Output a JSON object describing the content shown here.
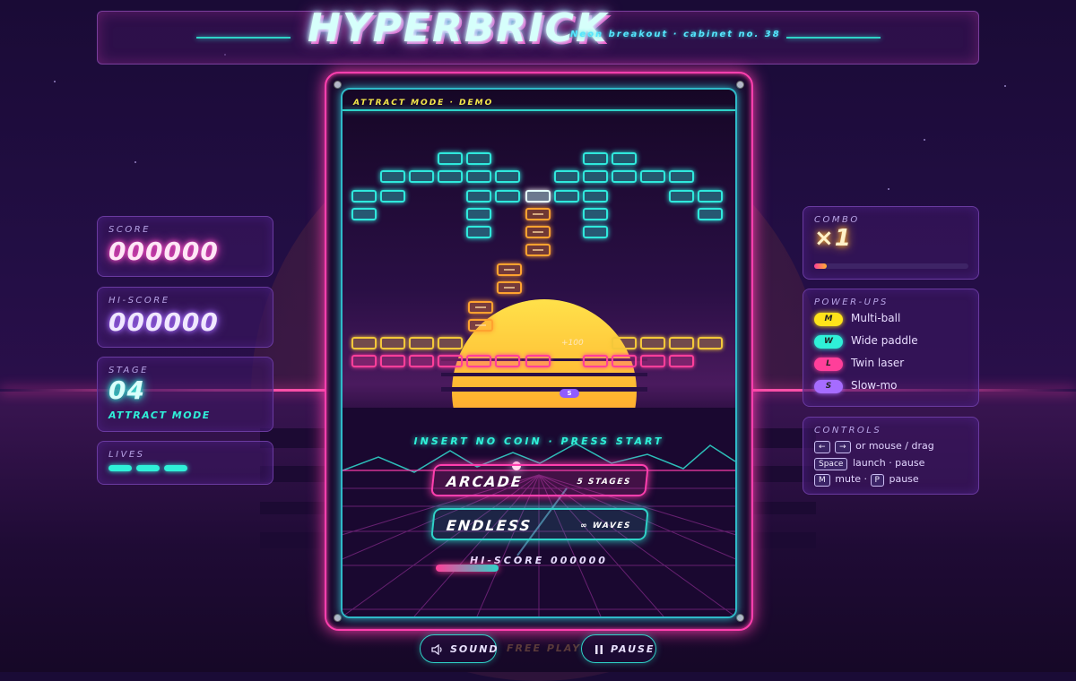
{
  "header": {
    "title": "HYPERBRICK",
    "tagline": "Neon breakout · cabinet no. 38"
  },
  "left_panels": {
    "score": {
      "label": "SCORE",
      "value": "000000"
    },
    "hiscore": {
      "label": "HI-SCORE",
      "value": "000000"
    },
    "stage": {
      "label": "STAGE",
      "value": "04",
      "mode": "ATTRACT MODE"
    },
    "lives": {
      "label": "LIVES",
      "count": 3
    }
  },
  "right_panels": {
    "combo": {
      "label": "COMBO",
      "value": "×1",
      "meter": 0.08
    },
    "powerups": {
      "label": "POWER-UPS",
      "items": [
        {
          "key": "M",
          "name": "Multi-ball",
          "color": "#ffe31a"
        },
        {
          "key": "W",
          "name": "Wide paddle",
          "color": "#2ff0d8"
        },
        {
          "key": "L",
          "name": "Twin laser",
          "color": "#ff3f9a"
        },
        {
          "key": "S",
          "name": "Slow-mo",
          "color": "#a66cff"
        }
      ]
    },
    "controls": {
      "label": "CONTROLS",
      "row1_keys": [
        "←",
        "→"
      ],
      "row1_text": "or mouse / drag",
      "row2_key": "Space",
      "row2_text": "launch · pause",
      "row3_key1": "M",
      "row3_mid": "mute ·",
      "row3_key2": "P",
      "row3_text": "pause"
    }
  },
  "game_screen": {
    "attract_label": "ATTRACT MODE · DEMO",
    "score_popup": "+100",
    "capsule_letter": "S",
    "insert_coin": "INSERT NO COIN · PRESS START",
    "menu": [
      {
        "label": "ARCADE",
        "detail": "5 STAGES",
        "color": "#ff3fae"
      },
      {
        "label": "ENDLESS",
        "detail": "∞ WAVES",
        "color": "#2fd3c8"
      }
    ],
    "hiscore_line": "HI-SCORE 000000"
  },
  "bottom_bar": {
    "sound_label": "SOUND",
    "free_play": "FREE PLAY",
    "pause_label": "PAUSE"
  },
  "icons": {
    "sound": "speaker-icon",
    "pause": "pause-icon"
  }
}
